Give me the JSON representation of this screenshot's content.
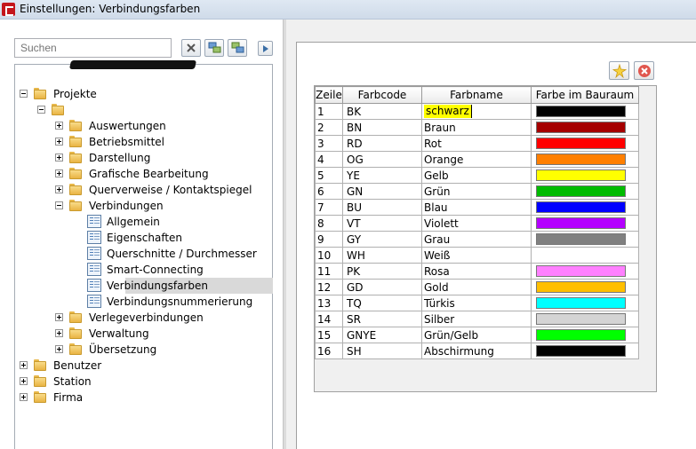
{
  "window": {
    "title": "Einstellungen: Verbindungsfarben"
  },
  "left": {
    "search_placeholder": "Suchen",
    "toolbar": {
      "clear_icon": "clear-filter-icon",
      "expand_icon": "expand-all-icon",
      "collapse_icon": "collapse-all-icon",
      "run_icon": "play-icon"
    },
    "tree": [
      {
        "label": "Projekte",
        "level": 0,
        "type": "folder",
        "expanded": true
      },
      {
        "label": "",
        "level": 1,
        "type": "folder",
        "expanded": true,
        "redacted": true
      },
      {
        "label": "Auswertungen",
        "level": 2,
        "type": "folder",
        "expanded": false
      },
      {
        "label": "Betriebsmittel",
        "level": 2,
        "type": "folder",
        "expanded": false
      },
      {
        "label": "Darstellung",
        "level": 2,
        "type": "folder",
        "expanded": false
      },
      {
        "label": "Grafische Bearbeitung",
        "level": 2,
        "type": "folder",
        "expanded": false
      },
      {
        "label": "Querverweise / Kontaktspiegel",
        "level": 2,
        "type": "folder",
        "expanded": false
      },
      {
        "label": "Verbindungen",
        "level": 2,
        "type": "folder",
        "expanded": true
      },
      {
        "label": "Allgemein",
        "level": 3,
        "type": "page"
      },
      {
        "label": "Eigenschaften",
        "level": 3,
        "type": "page"
      },
      {
        "label": "Querschnitte / Durchmesser",
        "level": 3,
        "type": "page"
      },
      {
        "label": "Smart-Connecting",
        "level": 3,
        "type": "page"
      },
      {
        "label": "Verbindungsfarben",
        "level": 3,
        "type": "page",
        "selected": true
      },
      {
        "label": "Verbindungsnummerierung",
        "level": 3,
        "type": "page"
      },
      {
        "label": "Verlegeverbindungen",
        "level": 2,
        "type": "folder",
        "expanded": false
      },
      {
        "label": "Verwaltung",
        "level": 2,
        "type": "folder",
        "expanded": false
      },
      {
        "label": "Übersetzung",
        "level": 2,
        "type": "folder",
        "expanded": false
      },
      {
        "label": "Benutzer",
        "level": 0,
        "type": "folder",
        "expanded": false
      },
      {
        "label": "Station",
        "level": 0,
        "type": "folder",
        "expanded": false
      },
      {
        "label": "Firma",
        "level": 0,
        "type": "folder",
        "expanded": false
      }
    ]
  },
  "right": {
    "buttons": {
      "new_icon": "new-star-icon",
      "delete_icon": "delete-x-icon"
    },
    "table": {
      "headers": [
        "Zeile",
        "Farbcode",
        "Farbname",
        "Farbe im Bauraum"
      ],
      "rows": [
        {
          "nr": "1",
          "code": "BK",
          "name": "schwarz",
          "color": "#000000",
          "editing": true
        },
        {
          "nr": "2",
          "code": "BN",
          "name": "Braun",
          "color": "#a50000"
        },
        {
          "nr": "3",
          "code": "RD",
          "name": "Rot",
          "color": "#ff0000"
        },
        {
          "nr": "4",
          "code": "OG",
          "name": "Orange",
          "color": "#ff7f00"
        },
        {
          "nr": "5",
          "code": "YE",
          "name": "Gelb",
          "color": "#ffff00"
        },
        {
          "nr": "6",
          "code": "GN",
          "name": "Grün",
          "color": "#00bb00"
        },
        {
          "nr": "7",
          "code": "BU",
          "name": "Blau",
          "color": "#0000ff"
        },
        {
          "nr": "8",
          "code": "VT",
          "name": "Violett",
          "color": "#b400ff"
        },
        {
          "nr": "9",
          "code": "GY",
          "name": "Grau",
          "color": "#808080"
        },
        {
          "nr": "10",
          "code": "WH",
          "name": "Weiß",
          "color": ""
        },
        {
          "nr": "11",
          "code": "PK",
          "name": "Rosa",
          "color": "#ff80ff"
        },
        {
          "nr": "12",
          "code": "GD",
          "name": "Gold",
          "color": "#ffbf00"
        },
        {
          "nr": "13",
          "code": "TQ",
          "name": "Türkis",
          "color": "#00ffff"
        },
        {
          "nr": "14",
          "code": "SR",
          "name": "Silber",
          "color": "#d4d4d4"
        },
        {
          "nr": "15",
          "code": "GNYE",
          "name": "Grün/Gelb",
          "color": "#00ff00"
        },
        {
          "nr": "16",
          "code": "SH",
          "name": "Abschirmung",
          "color": "#000000"
        }
      ]
    }
  }
}
